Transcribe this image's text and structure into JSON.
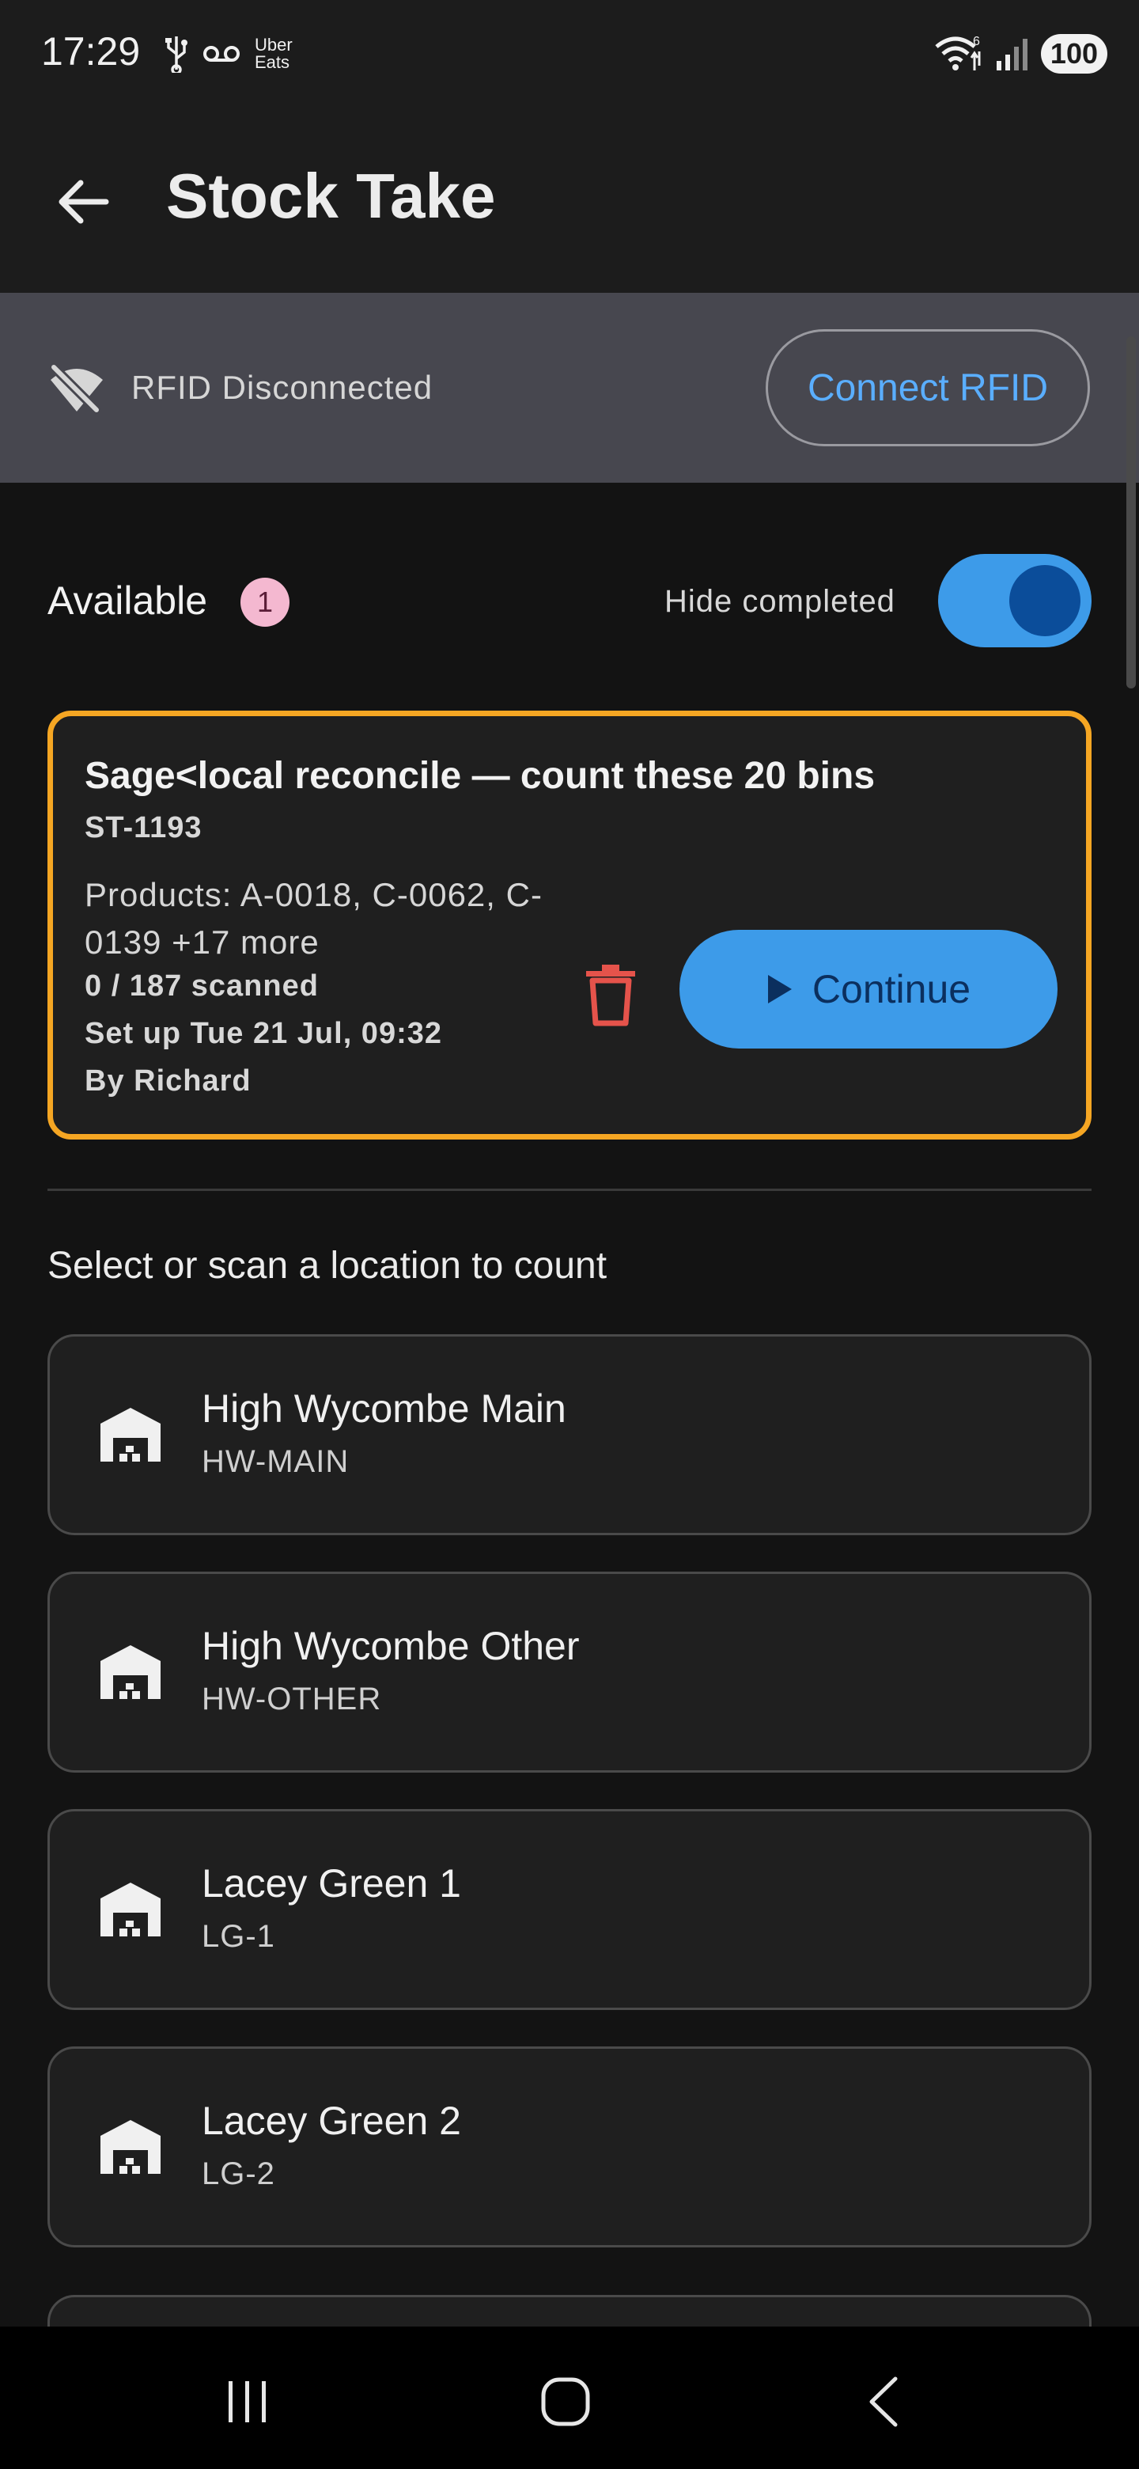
{
  "status_bar": {
    "time": "17:29",
    "uber_line1": "Uber",
    "uber_line2": "Eats",
    "battery": "100",
    "wifi_sub": "6"
  },
  "app_bar": {
    "title": "Stock Take",
    "back_icon": "arrow-left-icon"
  },
  "rfid": {
    "status_text": "RFID Disconnected",
    "connect_label": "Connect RFID",
    "icon": "wifi-off-icon"
  },
  "available": {
    "label": "Available",
    "count": "1",
    "hide_completed_label": "Hide completed",
    "hide_completed_on": true
  },
  "stock_take": {
    "title": "Sage<local reconcile — count these 20 bins",
    "id": "ST-1193",
    "products": "Products: A-0018, C-0062, C-0139 +17 more",
    "scanned": "0 / 187 scanned",
    "setup": "Set up Tue 21 Jul, 09:32",
    "by": "By Richard",
    "continue_label": "Continue",
    "border_color": "#f5a623"
  },
  "locations": {
    "heading": "Select or scan a location to count",
    "items": [
      {
        "name": "High Wycombe Main",
        "code": "HW-MAIN"
      },
      {
        "name": "High Wycombe Other",
        "code": "HW-OTHER"
      },
      {
        "name": "Lacey Green 1",
        "code": "LG-1"
      },
      {
        "name": "Lacey Green 2",
        "code": "LG-2"
      }
    ]
  },
  "colors": {
    "accent": "#3d9be9",
    "accent_text": "#5aaeff",
    "danger": "#e5534b",
    "badge": "#f4b8d0"
  }
}
